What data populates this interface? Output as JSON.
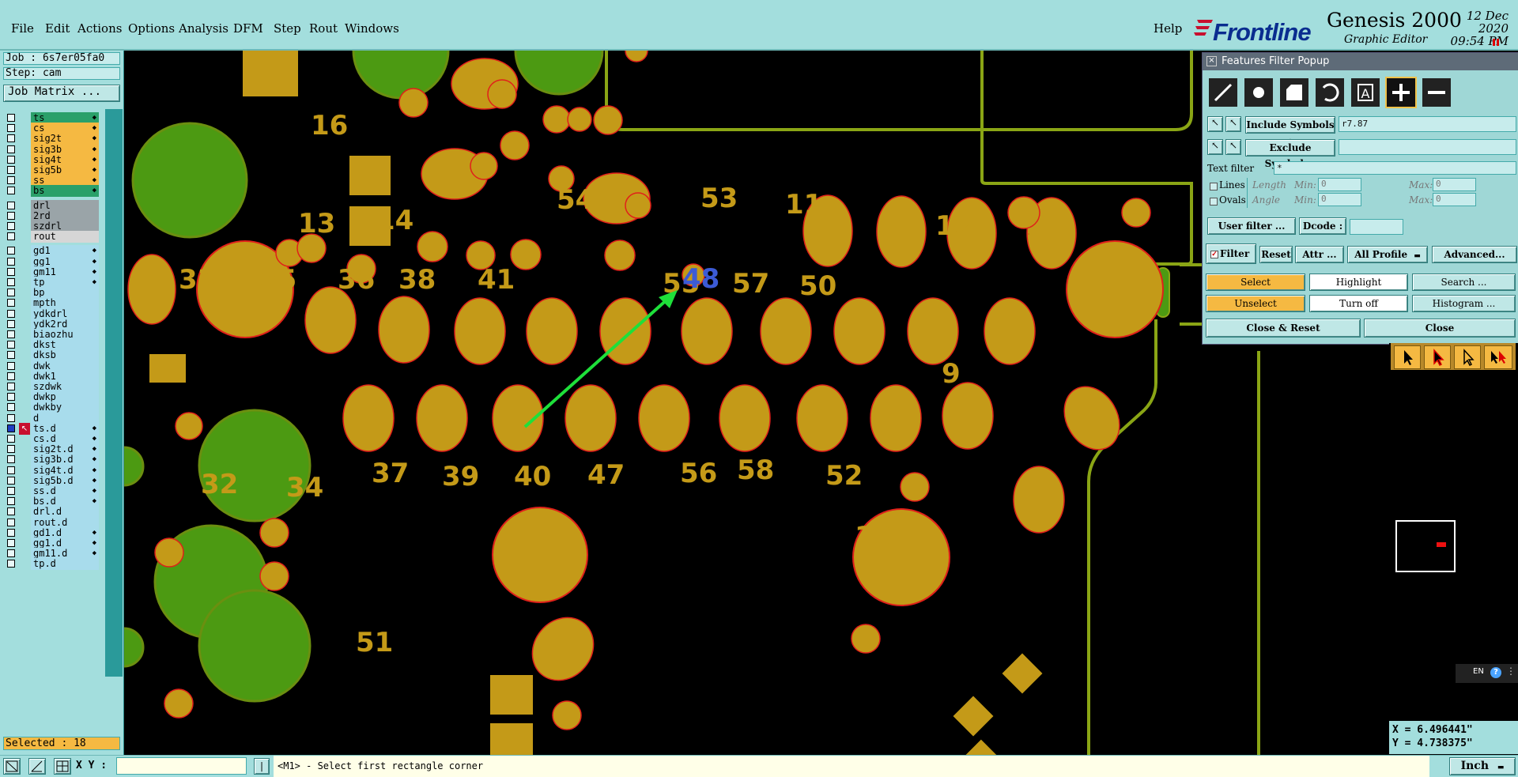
{
  "menubar": {
    "items": [
      "File",
      "Edit",
      "Actions",
      "Options",
      "Analysis",
      "DFM",
      "Step",
      "Rout",
      "Windows"
    ],
    "help": "Help"
  },
  "brand": {
    "logo": "Frontline",
    "product": "Genesis 2000",
    "subtitle": "Graphic Editor",
    "date": "12 Dec 2020",
    "time": "09:54 PM"
  },
  "left_panel": {
    "job": "Job : 6s7er05fa0",
    "step": "Step: cam",
    "job_matrix_button": "Job Matrix ...",
    "selected": "Selected : 18",
    "layers": [
      {
        "name": "ts",
        "color": "#2aa06a",
        "work": true,
        "star": true
      },
      {
        "name": "cs",
        "color": "#f5b942",
        "star": true
      },
      {
        "name": "sig2t",
        "color": "#f5b942",
        "star": true
      },
      {
        "name": "sig3b",
        "color": "#f5b942",
        "star": true
      },
      {
        "name": "sig4t",
        "color": "#f5b942",
        "star": true
      },
      {
        "name": "sig5b",
        "color": "#f5b942",
        "star": true
      },
      {
        "name": "ss",
        "color": "#f5b942",
        "star": true
      },
      {
        "name": "bs",
        "color": "#2aa06a",
        "star": true
      },
      {
        "name": "drl",
        "color": "#9aa4a8",
        "gap": true
      },
      {
        "name": "2rd",
        "color": "#9aa4a8"
      },
      {
        "name": "szdrl",
        "color": "#9aa4a8"
      },
      {
        "name": "rout",
        "color": "#d6d6d6"
      },
      {
        "name": "gd1",
        "color": "#a8dcec",
        "gap": true,
        "star": true
      },
      {
        "name": "gg1",
        "color": "#a8dcec",
        "star": true
      },
      {
        "name": "gm11",
        "color": "#a8dcec",
        "star": true
      },
      {
        "name": "tp",
        "color": "#a8dcec",
        "star": true
      },
      {
        "name": "bp",
        "color": "#a8dcec"
      },
      {
        "name": "mpth",
        "color": "#a8dcec"
      },
      {
        "name": "ydkdrl",
        "color": "#a8dcec"
      },
      {
        "name": "ydk2rd",
        "color": "#a8dcec"
      },
      {
        "name": "biaozhu",
        "color": "#a8dcec"
      },
      {
        "name": "dkst",
        "color": "#a8dcec"
      },
      {
        "name": "dksb",
        "color": "#a8dcec"
      },
      {
        "name": "dwk",
        "color": "#a8dcec"
      },
      {
        "name": "dwk1",
        "color": "#a8dcec"
      },
      {
        "name": "szdwk",
        "color": "#a8dcec"
      },
      {
        "name": "dwkp",
        "color": "#a8dcec"
      },
      {
        "name": "dwkby",
        "color": "#a8dcec"
      },
      {
        "name": "d",
        "color": "#a8dcec"
      },
      {
        "name": "ts.d",
        "color": "#a8dcec",
        "active": true,
        "star": true
      },
      {
        "name": "cs.d",
        "color": "#a8dcec",
        "star": true
      },
      {
        "name": "sig2t.d",
        "color": "#a8dcec",
        "star": true
      },
      {
        "name": "sig3b.d",
        "color": "#a8dcec",
        "star": true
      },
      {
        "name": "sig4t.d",
        "color": "#a8dcec",
        "star": true
      },
      {
        "name": "sig5b.d",
        "color": "#a8dcec",
        "star": true
      },
      {
        "name": "ss.d",
        "color": "#a8dcec",
        "star": true
      },
      {
        "name": "bs.d",
        "color": "#a8dcec",
        "star": true
      },
      {
        "name": "drl.d",
        "color": "#a8dcec"
      },
      {
        "name": "rout.d",
        "color": "#a8dcec"
      },
      {
        "name": "gd1.d",
        "color": "#a8dcec",
        "star": true
      },
      {
        "name": "gg1.d",
        "color": "#a8dcec",
        "star": true
      },
      {
        "name": "gm11.d",
        "color": "#a8dcec",
        "star": true
      },
      {
        "name": "tp.d",
        "color": "#a8dcec"
      }
    ]
  },
  "features_filter": {
    "title": "Features Filter Popup",
    "include_label": "Include Symbols :",
    "include_value": "r7.87",
    "exclude_label": "Exclude Symbols :",
    "exclude_value": "",
    "text_filter_label": "Text filter",
    "text_filter_value": "*",
    "lines_label": "Lines",
    "ovals_label": "Ovals",
    "length_label": "Length",
    "angle_label": "Angle",
    "min_label": "Min:",
    "max_label": "Max:",
    "min_value": "0",
    "max_value": "0",
    "user_filter": "User filter ...",
    "dcode_label": "Dcode :",
    "filter_label": "Filter",
    "reset": "Reset",
    "attr": "Attr ...",
    "all_profile": "All Profile",
    "advanced": "Advanced...",
    "select": "Select",
    "highlight": "Highlight",
    "search": "Search ...",
    "unselect": "Unselect",
    "turn_off": "Turn off",
    "histogram": "Histogram ...",
    "close_reset": "Close & Reset",
    "close": "Close"
  },
  "right_panel": {
    "lang": "EN",
    "x_readout": "X = 6.496441\"",
    "y_readout": "Y = 4.738375\""
  },
  "bottom_bar": {
    "xy_label": "X Y :",
    "xy_value": "",
    "status": "<M1> - Select first rectangle corner",
    "units": "Inch"
  },
  "canvas": {
    "pad_labels": [
      "16",
      "13",
      "14",
      "54",
      "53",
      "11",
      "12",
      "33",
      "35",
      "36",
      "38",
      "41",
      "48",
      "55",
      "57",
      "50",
      "9",
      "32",
      "34",
      "37",
      "39",
      "40",
      "47",
      "56",
      "58",
      "52",
      "10",
      "51"
    ],
    "highlight_color": "#3c5bd6",
    "pad_color": "#c49a18",
    "plane_color": "#4c9a12",
    "arrow_color": "#1ee03a"
  }
}
